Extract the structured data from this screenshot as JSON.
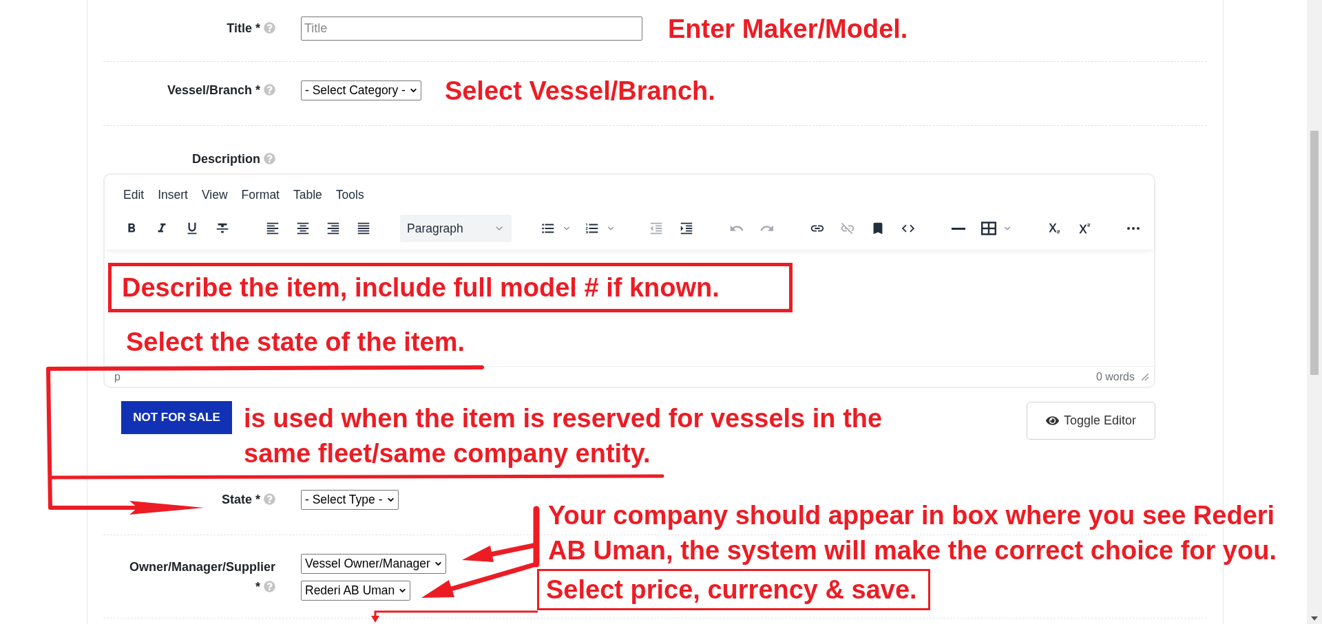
{
  "fields": [
    {
      "kind": "input",
      "label": "Title",
      "required_mark": "*",
      "placeholder": "Title",
      "note": "Enter Maker/Model."
    },
    {
      "kind": "select",
      "label": "Vessel/Branch",
      "required_mark": "*",
      "selected_values": [
        "- Select Category -"
      ],
      "note": "Select Vessel/Branch."
    },
    {
      "kind": "editor",
      "label": "Description",
      "editor": {
        "menu": [
          "Edit",
          "Insert",
          "View",
          "Format",
          "Table",
          "Tools"
        ],
        "toolbar_groups": [
          {
            "items": [
              {
                "kind": "bold",
                "disabled": false
              },
              {
                "kind": "italic",
                "disabled": false
              },
              {
                "kind": "underline",
                "disabled": false
              },
              {
                "kind": "strikethrough",
                "disabled": false
              }
            ]
          },
          {
            "items": [
              {
                "kind": "align-left",
                "disabled": false
              },
              {
                "kind": "align-center",
                "disabled": false
              },
              {
                "kind": "align-right",
                "disabled": false
              },
              {
                "kind": "align-justify",
                "disabled": false
              }
            ]
          },
          {
            "items": [
              {
                "kind": "block-format",
                "value": "Paragraph"
              }
            ]
          },
          {
            "items": [
              {
                "kind": "bullet-list",
                "disabled": false
              },
              {
                "kind": "numbered-list",
                "disabled": false
              }
            ]
          },
          {
            "items": [
              {
                "kind": "outdent",
                "disabled": true
              },
              {
                "kind": "indent",
                "disabled": false
              }
            ]
          },
          {
            "items": [
              {
                "kind": "undo",
                "disabled": true
              },
              {
                "kind": "redo",
                "disabled": true
              }
            ]
          },
          {
            "items": [
              {
                "kind": "link",
                "disabled": false
              },
              {
                "kind": "unlink",
                "disabled": true
              },
              {
                "kind": "bookmark",
                "disabled": false
              },
              {
                "kind": "code",
                "disabled": false
              }
            ]
          },
          {
            "items": [
              {
                "kind": "horizontal-line",
                "disabled": false
              },
              {
                "kind": "table",
                "disabled": false
              }
            ]
          },
          {
            "items": [
              {
                "kind": "subscript",
                "disabled": false
              },
              {
                "kind": "superscript",
                "disabled": false
              }
            ]
          },
          {
            "items": [
              {
                "kind": "more",
                "disabled": false
              }
            ]
          }
        ],
        "content": [
          {
            "kind": "boxed",
            "text": "Describe the item, include full model # if known."
          },
          {
            "kind": "plain",
            "text": "Select the state of the item."
          }
        ],
        "element_path": "p",
        "word_count": "0 words"
      },
      "badge": "NOT FOR SALE",
      "badge_note": "is used when the item is reserved for vessels in the same fleet/same company entity.",
      "toggle_button": "Toggle Editor"
    },
    {
      "kind": "select",
      "label": "State",
      "required_mark": "*",
      "selected_values": [
        "- Select Type -"
      ]
    },
    {
      "kind": "select",
      "label": "Owner/Manager/Supplier",
      "required_mark": "*",
      "selected_values": [
        "Vessel Owner/Manager",
        "Rederi AB Uman"
      ]
    }
  ],
  "annotations": {
    "company_note": "Your company should appear in box where you see Rederi AB Uman, the system will make the correct choice for you.",
    "price_note": "Select price, currency & save."
  }
}
